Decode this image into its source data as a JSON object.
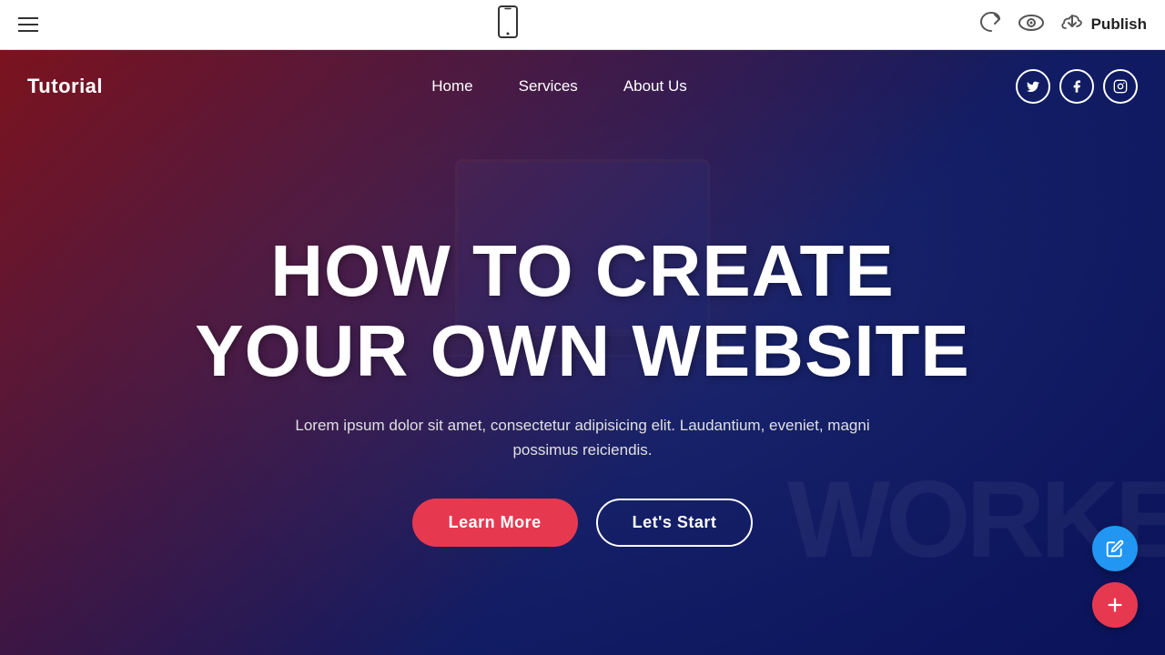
{
  "toolbar": {
    "hamburger_label": "menu",
    "phone_icon": "📱",
    "undo_label": "undo",
    "preview_label": "preview",
    "publish_label": "Publish",
    "publish_cloud": "☁"
  },
  "site": {
    "logo": "Tutorial",
    "nav": {
      "items": [
        {
          "label": "Home",
          "id": "home"
        },
        {
          "label": "Services",
          "id": "services"
        },
        {
          "label": "About Us",
          "id": "about-us"
        }
      ]
    },
    "social": {
      "twitter": "𝕏",
      "facebook": "f",
      "instagram": "⬡"
    }
  },
  "hero": {
    "title_line1": "HOW TO CREATE",
    "title_line2": "YOUR OWN WEBSITE",
    "description": "Lorem ipsum dolor sit amet, consectetur adipisicing elit. Laudantium, eveniet, magni possimus reiciendis.",
    "btn_learn_more": "Learn More",
    "btn_lets_start": "Let's Start"
  },
  "deco_text": "WORKE",
  "colors": {
    "accent_red": "#e63950",
    "accent_blue": "#2196f3",
    "hero_overlay_start": "rgba(160,20,30,0.75)",
    "hero_overlay_end": "rgba(10,20,100,0.85)"
  }
}
